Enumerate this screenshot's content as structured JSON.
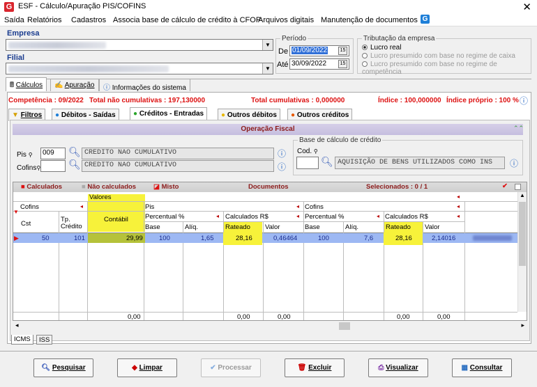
{
  "window": {
    "title": "ESF - Cálculo/Apuração PIS/COFINS",
    "close": "✕"
  },
  "menu": [
    "Saída",
    "Relatórios",
    "Cadastros",
    "Associa base de cálculo de crédito à CFOP",
    "Arquivos digitais",
    "Manutenção de documentos"
  ],
  "empresa": {
    "label": "Empresa"
  },
  "filial": {
    "label": "Filial"
  },
  "periodo": {
    "legend": "Período",
    "de_label": "De",
    "de_value": "01/09/2022",
    "ate_label": "Até",
    "ate_value": "30/09/2022"
  },
  "tributacao": {
    "legend": "Tributação da empresa",
    "options": [
      "Lucro real",
      "Lucro presumido com base no regime de caixa",
      "Lucro presumido com base no regime de competência"
    ]
  },
  "tabs": [
    "Cálculos",
    "Apuração",
    "Informações do sistema"
  ],
  "info": {
    "competencia": "Competência : 09/2022",
    "total_nao_cumulativas": "Total não cumulativas : 197,130000",
    "total_cumulativas": "Total cumulativas : 0,000000",
    "indice": "Índice : 100,000000",
    "indice_proprio": "Índice próprio : 100 %"
  },
  "subtabs": [
    "Filtros",
    "Débitos - Saídas",
    "Créditos - Entradas",
    "Outros débitos",
    "Outros créditos"
  ],
  "operacao_fiscal": {
    "title": "Operação Fiscal",
    "pis_label": "Pis",
    "pis_code": "009",
    "pis_desc": "CREDITO NAO CUMULATIVO",
    "cofins_label": "Cofins",
    "cofins_desc": "CREDITO NAO CUMULATIVO"
  },
  "base_calculo": {
    "legend": "Base de cálculo de crédito",
    "cod_label": "Cod.",
    "desc": "AQUISIÇÃO DE BENS UTILIZADOS COMO INS"
  },
  "grid": {
    "legend_calculados": "Calculados",
    "legend_nao_calculados": "Não calculados",
    "legend_misto": "Misto",
    "documentos": "Documentos",
    "selecionados": "Selecionados : 0 / 1",
    "h_valores": "Valores",
    "h_cofins": "Cofins",
    "h_pis": "Pis",
    "h_cofins2": "Cofins",
    "h_cst": "Cst",
    "h_tp": "Tp.",
    "h_credito": "Crédito",
    "h_contabil": "Contábil",
    "h_percentual": "Percentual %",
    "h_calculados": "Calculados R$",
    "h_percentual2": "Percentual %",
    "h_calculados2": "Calculados R$",
    "h_base": "Base",
    "h_aliq": "Alíq.",
    "h_rateado": "Rateado",
    "h_valor": "Valor",
    "h_base2": "Base",
    "h_aliq2": "Alíq.",
    "h_rateado2": "Rateado",
    "h_valor2": "Valor",
    "row": {
      "cst": "50",
      "tp": "101",
      "contabil": "29,99",
      "base": "100",
      "aliq": "1,65",
      "rateado": "28,16",
      "valor": "0,46464",
      "base2": "100",
      "aliq2": "7,6",
      "rateado2": "28,16",
      "valor2": "2,14016"
    },
    "totals": {
      "contabil": "0,00",
      "rateado": "0,00",
      "valor": "0,00",
      "rateado2": "0,00",
      "valor2": "0,00"
    }
  },
  "bottom_tabs": [
    "ICMS",
    "ISS"
  ],
  "buttons": {
    "pesquisar": "Pesquisar",
    "limpar": "Limpar",
    "processar": "Processar",
    "excluir": "Excluir",
    "visualizar": "Visualizar",
    "consultar": "Consultar"
  },
  "colors": {
    "accent_red": "#dd1111",
    "row_blue": "#1a3c8f",
    "highlight": "#f7f23a"
  }
}
